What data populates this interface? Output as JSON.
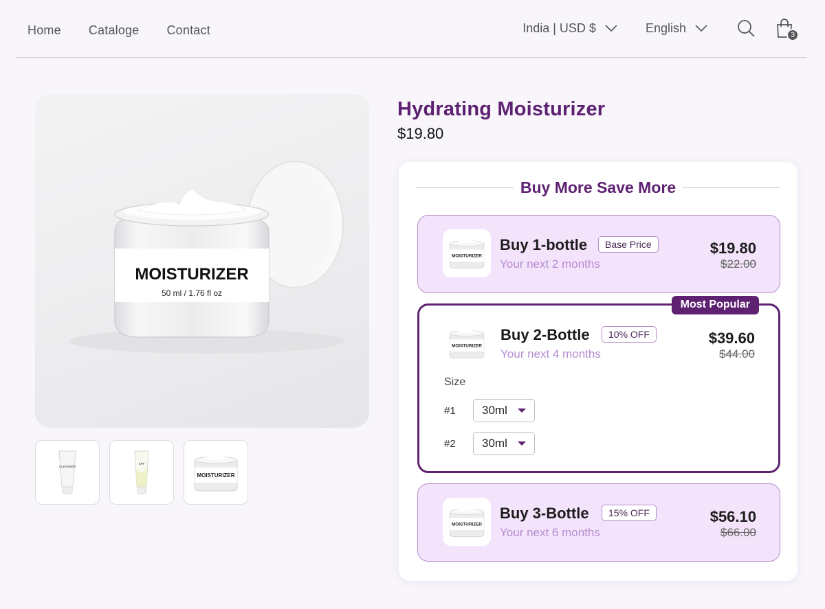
{
  "nav": {
    "items": [
      {
        "label": "Home"
      },
      {
        "label": "Cataloge"
      },
      {
        "label": "Contact"
      }
    ],
    "region_label": "India | USD $",
    "language_label": "English",
    "cart_count": "3"
  },
  "gallery": {
    "main_label": "MOISTURIZER",
    "main_size": "50 ml / 1.76 fl oz",
    "thumbs": [
      {
        "label": "CLEANSER"
      },
      {
        "label": "SPF"
      },
      {
        "label": "MOISTURIZER"
      }
    ]
  },
  "product": {
    "title": "Hydrating Moisturizer",
    "price": "$19.80"
  },
  "bundle": {
    "heading": "Buy More Save More",
    "offers": [
      {
        "title": "Buy 1-bottle",
        "tag": "Base Price",
        "subtitle": "Your next 2 months",
        "price": "$19.80",
        "compare_price": "$22.00",
        "selected": false
      },
      {
        "title": "Buy 2-Bottle",
        "tag": "10% OFF",
        "subtitle": "Your next 4 months",
        "price": "$39.60",
        "compare_price": "$44.00",
        "selected": true,
        "badge": "Most Popular",
        "size_label": "Size",
        "variants": [
          {
            "num": "#1",
            "value": "30ml"
          },
          {
            "num": "#2",
            "value": "30ml"
          }
        ]
      },
      {
        "title": "Buy 3-Bottle",
        "tag": "15% OFF",
        "subtitle": "Your next 6 months",
        "price": "$56.10",
        "compare_price": "$66.00",
        "selected": false
      }
    ],
    "jar_label": "MOISTURIZER"
  },
  "colors": {
    "brand": "#5e2172",
    "offer_bg": "#f4e4fb",
    "subtitle": "#b48ad0"
  }
}
